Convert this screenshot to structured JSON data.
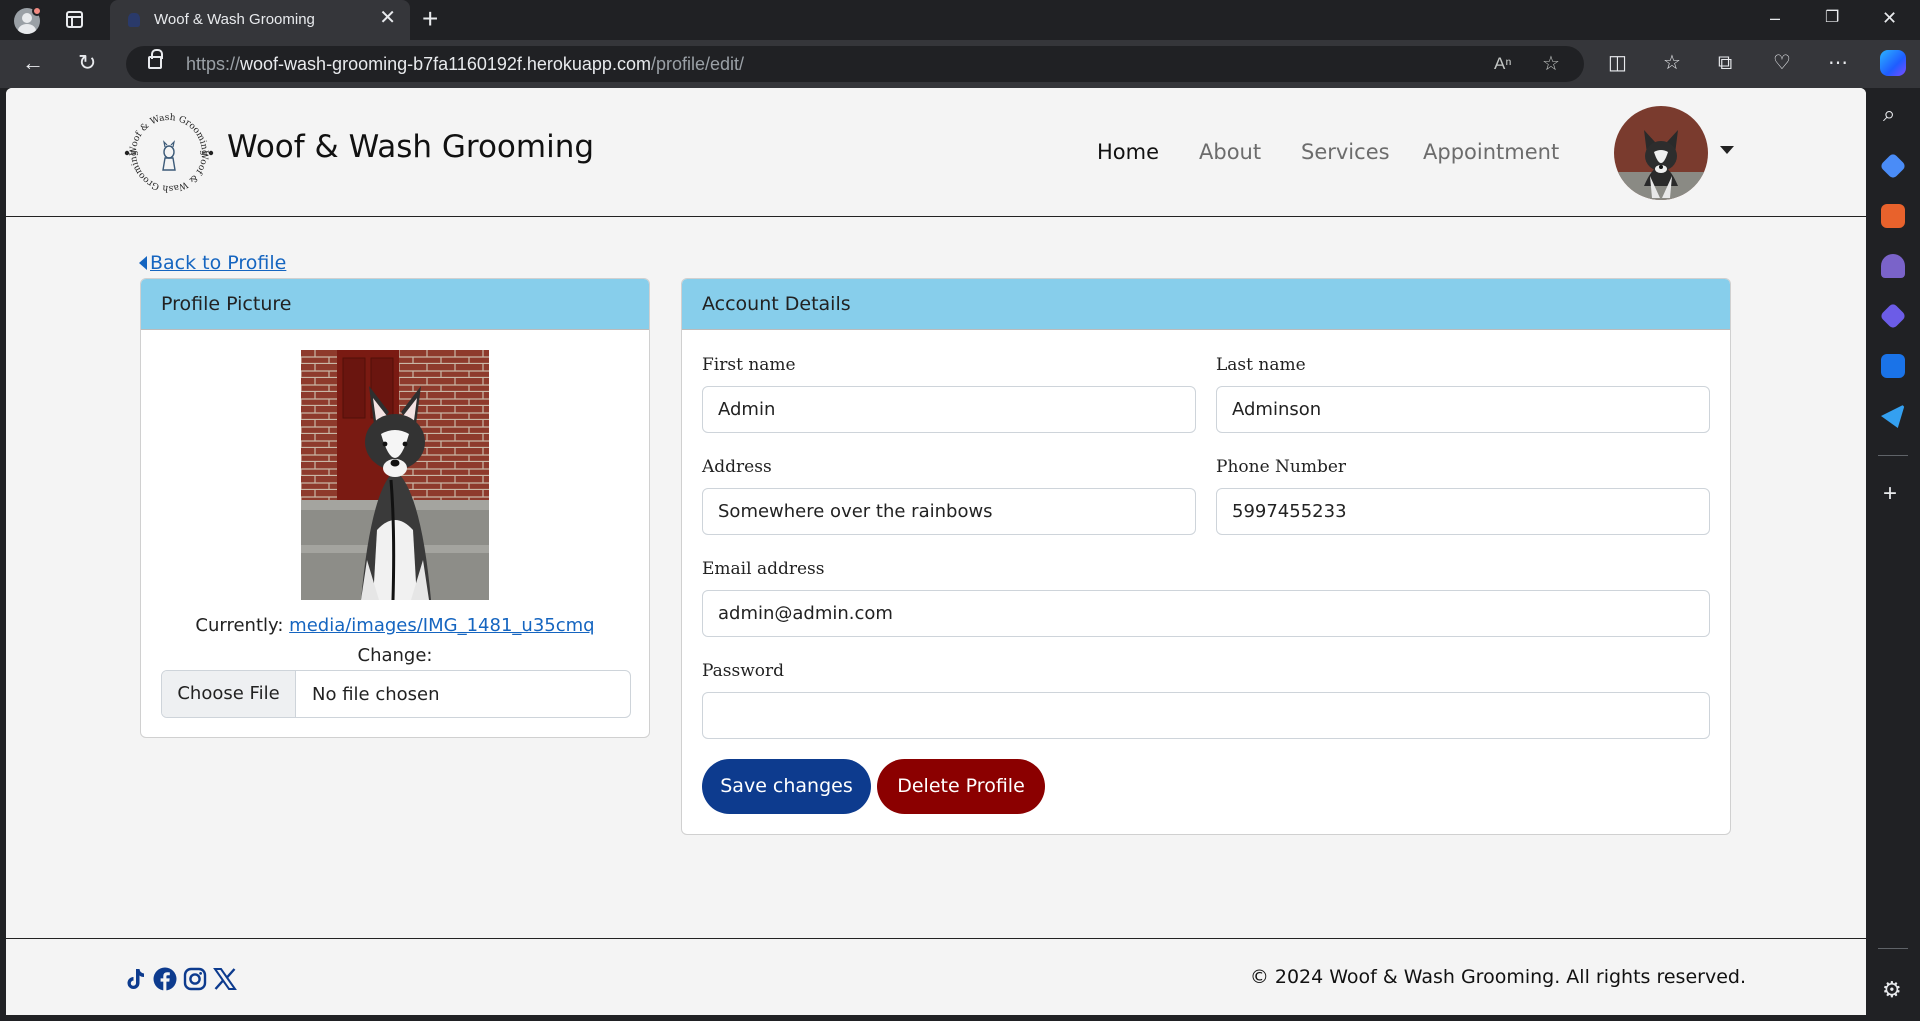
{
  "browser": {
    "tab_title": "Woof & Wash Grooming",
    "url_scheme": "https://",
    "url_host": "woof-wash-grooming-b7fa1160192f.herokuapp.com",
    "url_path": "/profile/edit/"
  },
  "site": {
    "brand": "Woof & Wash Grooming",
    "logo_text": "Woof & Wash Grooming",
    "nav": [
      {
        "label": "Home",
        "active": true
      },
      {
        "label": "About",
        "active": false
      },
      {
        "label": "Services",
        "active": false
      },
      {
        "label": "Appointment",
        "active": false
      }
    ]
  },
  "back_link": "Back to Profile",
  "profile_card": {
    "title": "Profile Picture",
    "currently_label": "Currently:",
    "current_file": "media/images/IMG_1481_u35cmq",
    "change_label": "Change:",
    "file_button": "Choose File",
    "file_status": "No file chosen"
  },
  "account_card": {
    "title": "Account Details",
    "first_name_label": "First name",
    "first_name": "Admin",
    "last_name_label": "Last name",
    "last_name": "Adminson",
    "address_label": "Address",
    "address": "Somewhere over the rainbows",
    "phone_label": "Phone Number",
    "phone": "5997455233",
    "email_label": "Email address",
    "email": "admin@admin.com",
    "password_label": "Password",
    "password": "",
    "save_button": "Save changes",
    "delete_button": "Delete Profile"
  },
  "footer": {
    "social": [
      "tiktok-icon",
      "facebook-icon",
      "instagram-icon",
      "x-icon"
    ],
    "copyright": "© 2024 Woof & Wash Grooming. All rights reserved."
  },
  "colors": {
    "card_header": "#87ceeb",
    "save_button": "#0d3b8e",
    "delete_button": "#8b0000",
    "link": "#1565c0",
    "social_icons": "#0d3b8e"
  }
}
